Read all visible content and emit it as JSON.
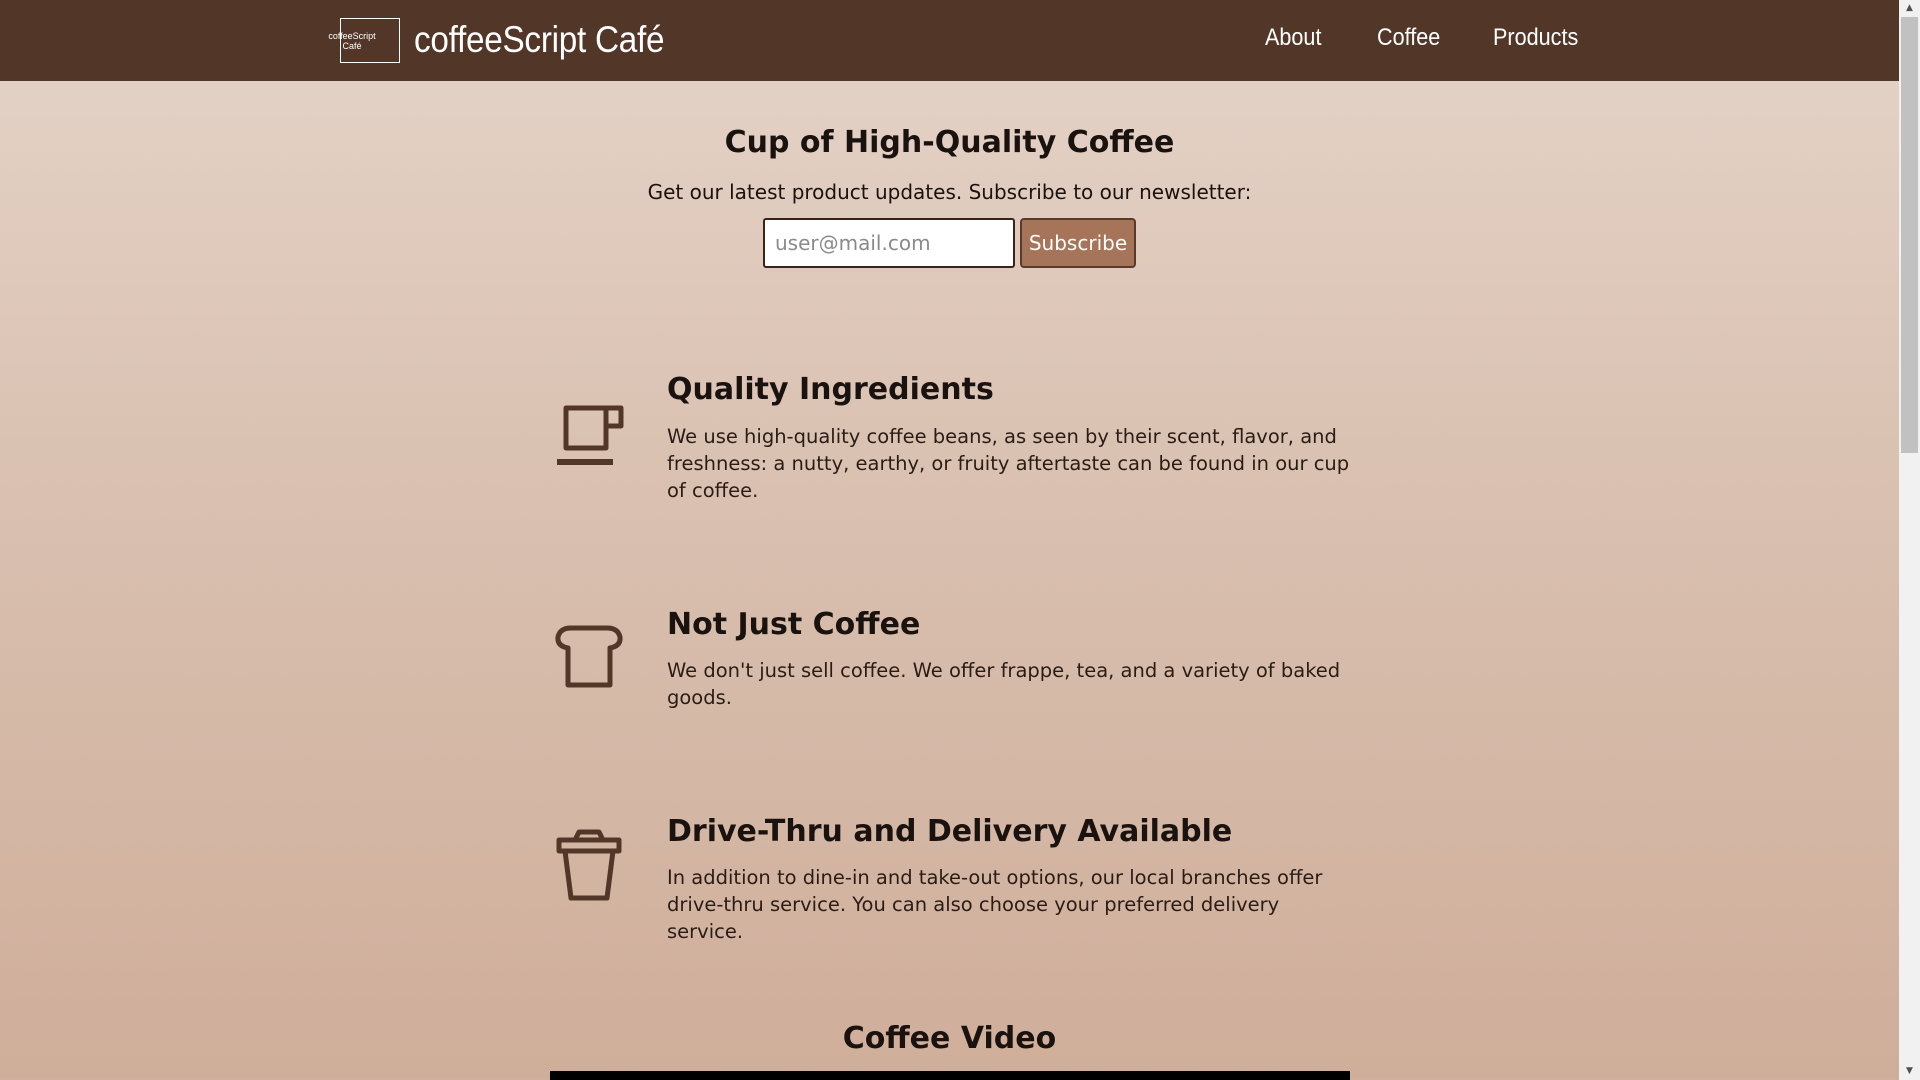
{
  "colors": {
    "header_bg": "#523729",
    "icon": "#523729",
    "button_bg": "#a67458",
    "gradient_top": "#e5d4c9",
    "gradient_bottom": "#cfae9a"
  },
  "header": {
    "logo_text": "coffeeScript Café",
    "brand_name": "coffeeScript Café",
    "nav": [
      {
        "label": "About"
      },
      {
        "label": "Coffee"
      },
      {
        "label": "Products"
      }
    ]
  },
  "hero": {
    "title": "Cup of High-Quality Coffee",
    "subtitle": "Get our latest product updates. Subscribe to our newsletter:",
    "email_placeholder": "user@mail.com",
    "email_value": "",
    "subscribe_label": "Subscribe"
  },
  "features": [
    {
      "icon": "coffee-cup-icon",
      "title": "Quality Ingredients",
      "text": "We use high-quality coffee beans, as seen by their scent, flavor, and freshness: a nutty, earthy, or fruity aftertaste can be found in our cup of coffee."
    },
    {
      "icon": "bread-icon",
      "title": "Not Just Coffee",
      "text": "We don't just sell coffee. We offer frappe, tea, and a variety of baked goods."
    },
    {
      "icon": "takeaway-cup-icon",
      "title": "Drive-Thru and Delivery Available",
      "text": "In addition to dine-in and take-out options, our local branches offer drive-thru service. You can also choose your preferred delivery service."
    }
  ],
  "video": {
    "title": "Coffee Video"
  }
}
